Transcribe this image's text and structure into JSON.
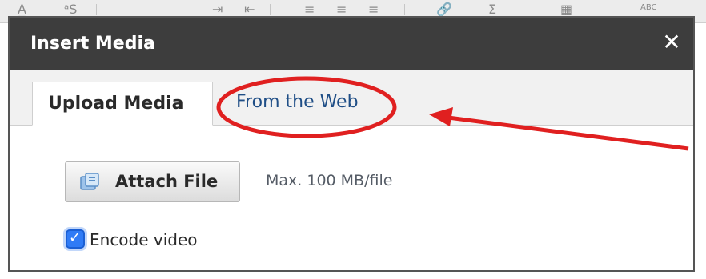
{
  "toolbar": {
    "icons": [
      "text-color-icon",
      "font-size-icon",
      "indent-icon",
      "outdent-icon",
      "align-left-icon",
      "align-center-icon",
      "align-right-icon",
      "link-icon",
      "math-icon",
      "table-icon",
      "spellcheck-icon"
    ],
    "spellcheck_label": "ABC"
  },
  "dialog": {
    "title": "Insert Media",
    "close_label": "✕",
    "tabs": [
      {
        "label": "Upload Media",
        "active": true
      },
      {
        "label": "From the Web",
        "active": false
      }
    ],
    "attach_label": "Attach File",
    "max_size": "Max. 100 MB/file",
    "encode_label": "Encode video",
    "encode_checked": true
  },
  "colors": {
    "titlebar": "#3d3d3d",
    "link": "#1f4e86",
    "checkbox": "#2f7bf6",
    "annotation": "#e02020"
  }
}
